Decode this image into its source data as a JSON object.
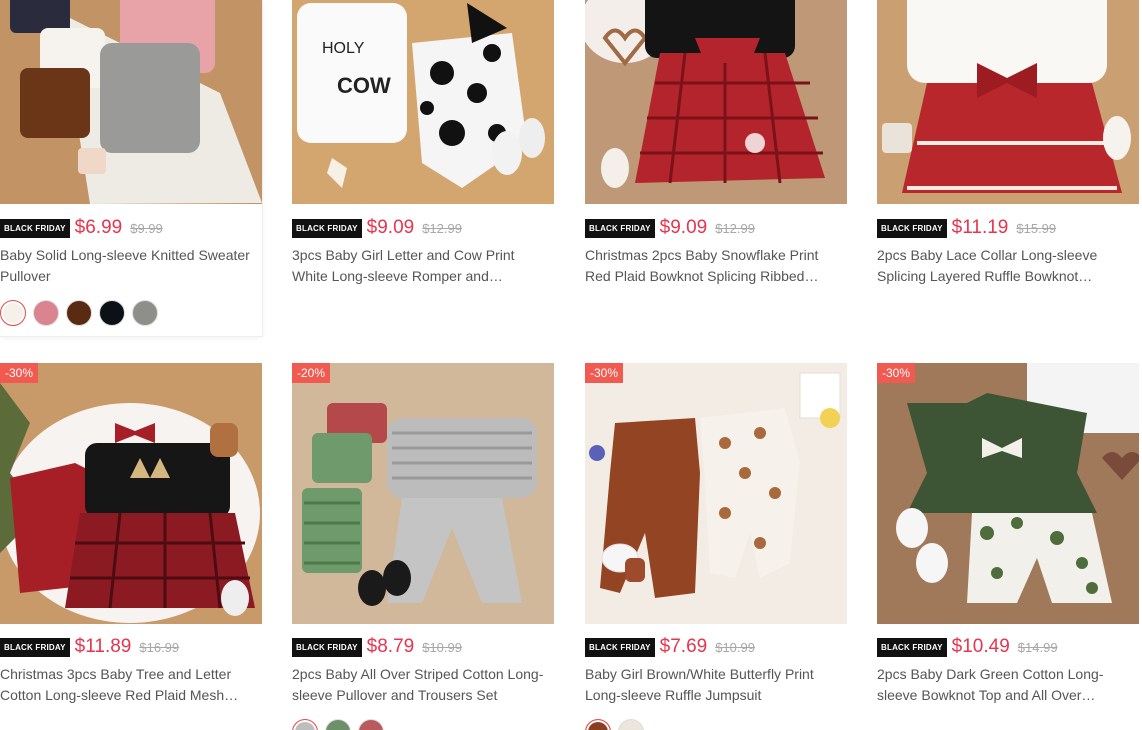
{
  "colors": {
    "accent_price": "#e8344e",
    "discount_badge": "#f15a50",
    "black_friday_bg": "#111111"
  },
  "products": [
    {
      "badge": "BLACK FRIDAY",
      "price": "$6.99",
      "original_price": "$9.99",
      "discount": "",
      "title": "Baby Solid Long-sleeve Knitted Sweater Pullover",
      "swatches": [
        "#f5f0ea",
        "#d9848f",
        "#5a2a12",
        "#0e1018",
        "#8e8e8a"
      ]
    },
    {
      "badge": "BLACK FRIDAY",
      "price": "$9.09",
      "original_price": "$12.99",
      "discount": "",
      "title": "3pcs Baby Girl Letter and Cow Print White Long-sleeve Romper and…"
    },
    {
      "badge": "BLACK FRIDAY",
      "price": "$9.09",
      "original_price": "$12.99",
      "discount": "",
      "title": "Christmas 2pcs Baby Snowflake Print Red Plaid Bowknot Splicing Ribbed…"
    },
    {
      "badge": "BLACK FRIDAY",
      "price": "$11.19",
      "original_price": "$15.99",
      "discount": "",
      "title": "2pcs Baby Lace Collar Long-sleeve Splicing Layered Ruffle Bowknot…"
    },
    {
      "badge": "BLACK FRIDAY",
      "price": "$11.89",
      "original_price": "$16.99",
      "discount": "-30%",
      "title": "Christmas 3pcs Baby Tree and Letter Cotton Long-sleeve Red Plaid Mesh…"
    },
    {
      "badge": "BLACK FRIDAY",
      "price": "$8.79",
      "original_price": "$10.99",
      "discount": "-20%",
      "title": "2pcs Baby All Over Striped Cotton Long-sleeve Pullover and Trousers Set",
      "swatches": [
        "#bdbdbd",
        "#6d8f6a",
        "#b85a5e"
      ]
    },
    {
      "badge": "BLACK FRIDAY",
      "price": "$7.69",
      "original_price": "$10.99",
      "discount": "-30%",
      "title": "Baby Girl Brown/White Butterfly Print Long-sleeve Ruffle Jumpsuit",
      "swatches": [
        "#8c3e22",
        "#ece5dc"
      ]
    },
    {
      "badge": "BLACK FRIDAY",
      "price": "$10.49",
      "original_price": "$14.99",
      "discount": "-30%",
      "title": "2pcs Baby Dark Green Cotton Long-sleeve Bowknot Top and All Over…"
    }
  ]
}
